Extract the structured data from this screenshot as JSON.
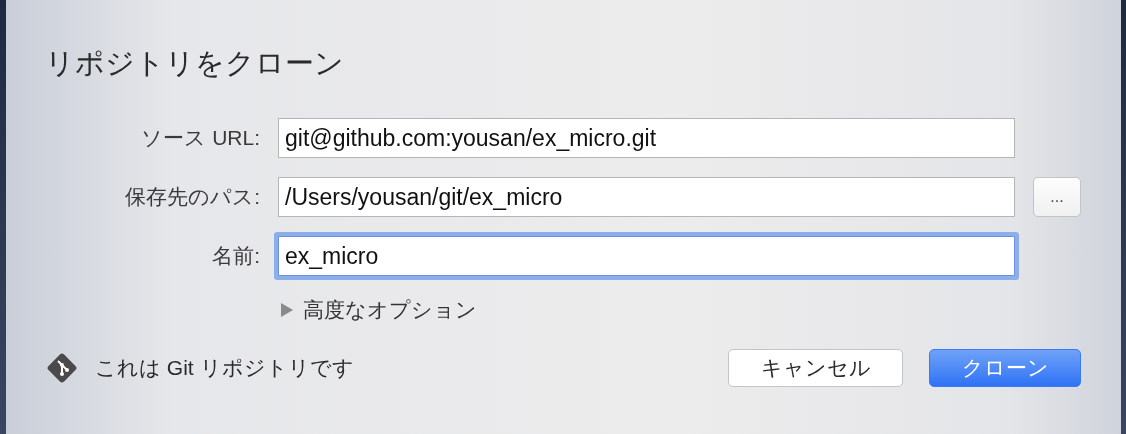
{
  "dialog": {
    "title": "リポジトリをクローン",
    "fields": [
      {
        "label": "ソース URL:",
        "value": "git@github.com:yousan/ex_micro.git",
        "focused": false
      },
      {
        "label": "保存先のパス:",
        "value": "/Users/yousan/git/ex_micro",
        "focused": false,
        "button": "..."
      },
      {
        "label": "名前:",
        "value": "ex_micro",
        "focused": true
      }
    ],
    "advanced_options": {
      "label": "高度なオプション",
      "expanded": false
    },
    "status": "これは Git リポジトリです",
    "buttons": [
      {
        "label": "キャンセル",
        "kind": "secondary"
      },
      {
        "label": "クローン",
        "kind": "primary"
      }
    ]
  }
}
